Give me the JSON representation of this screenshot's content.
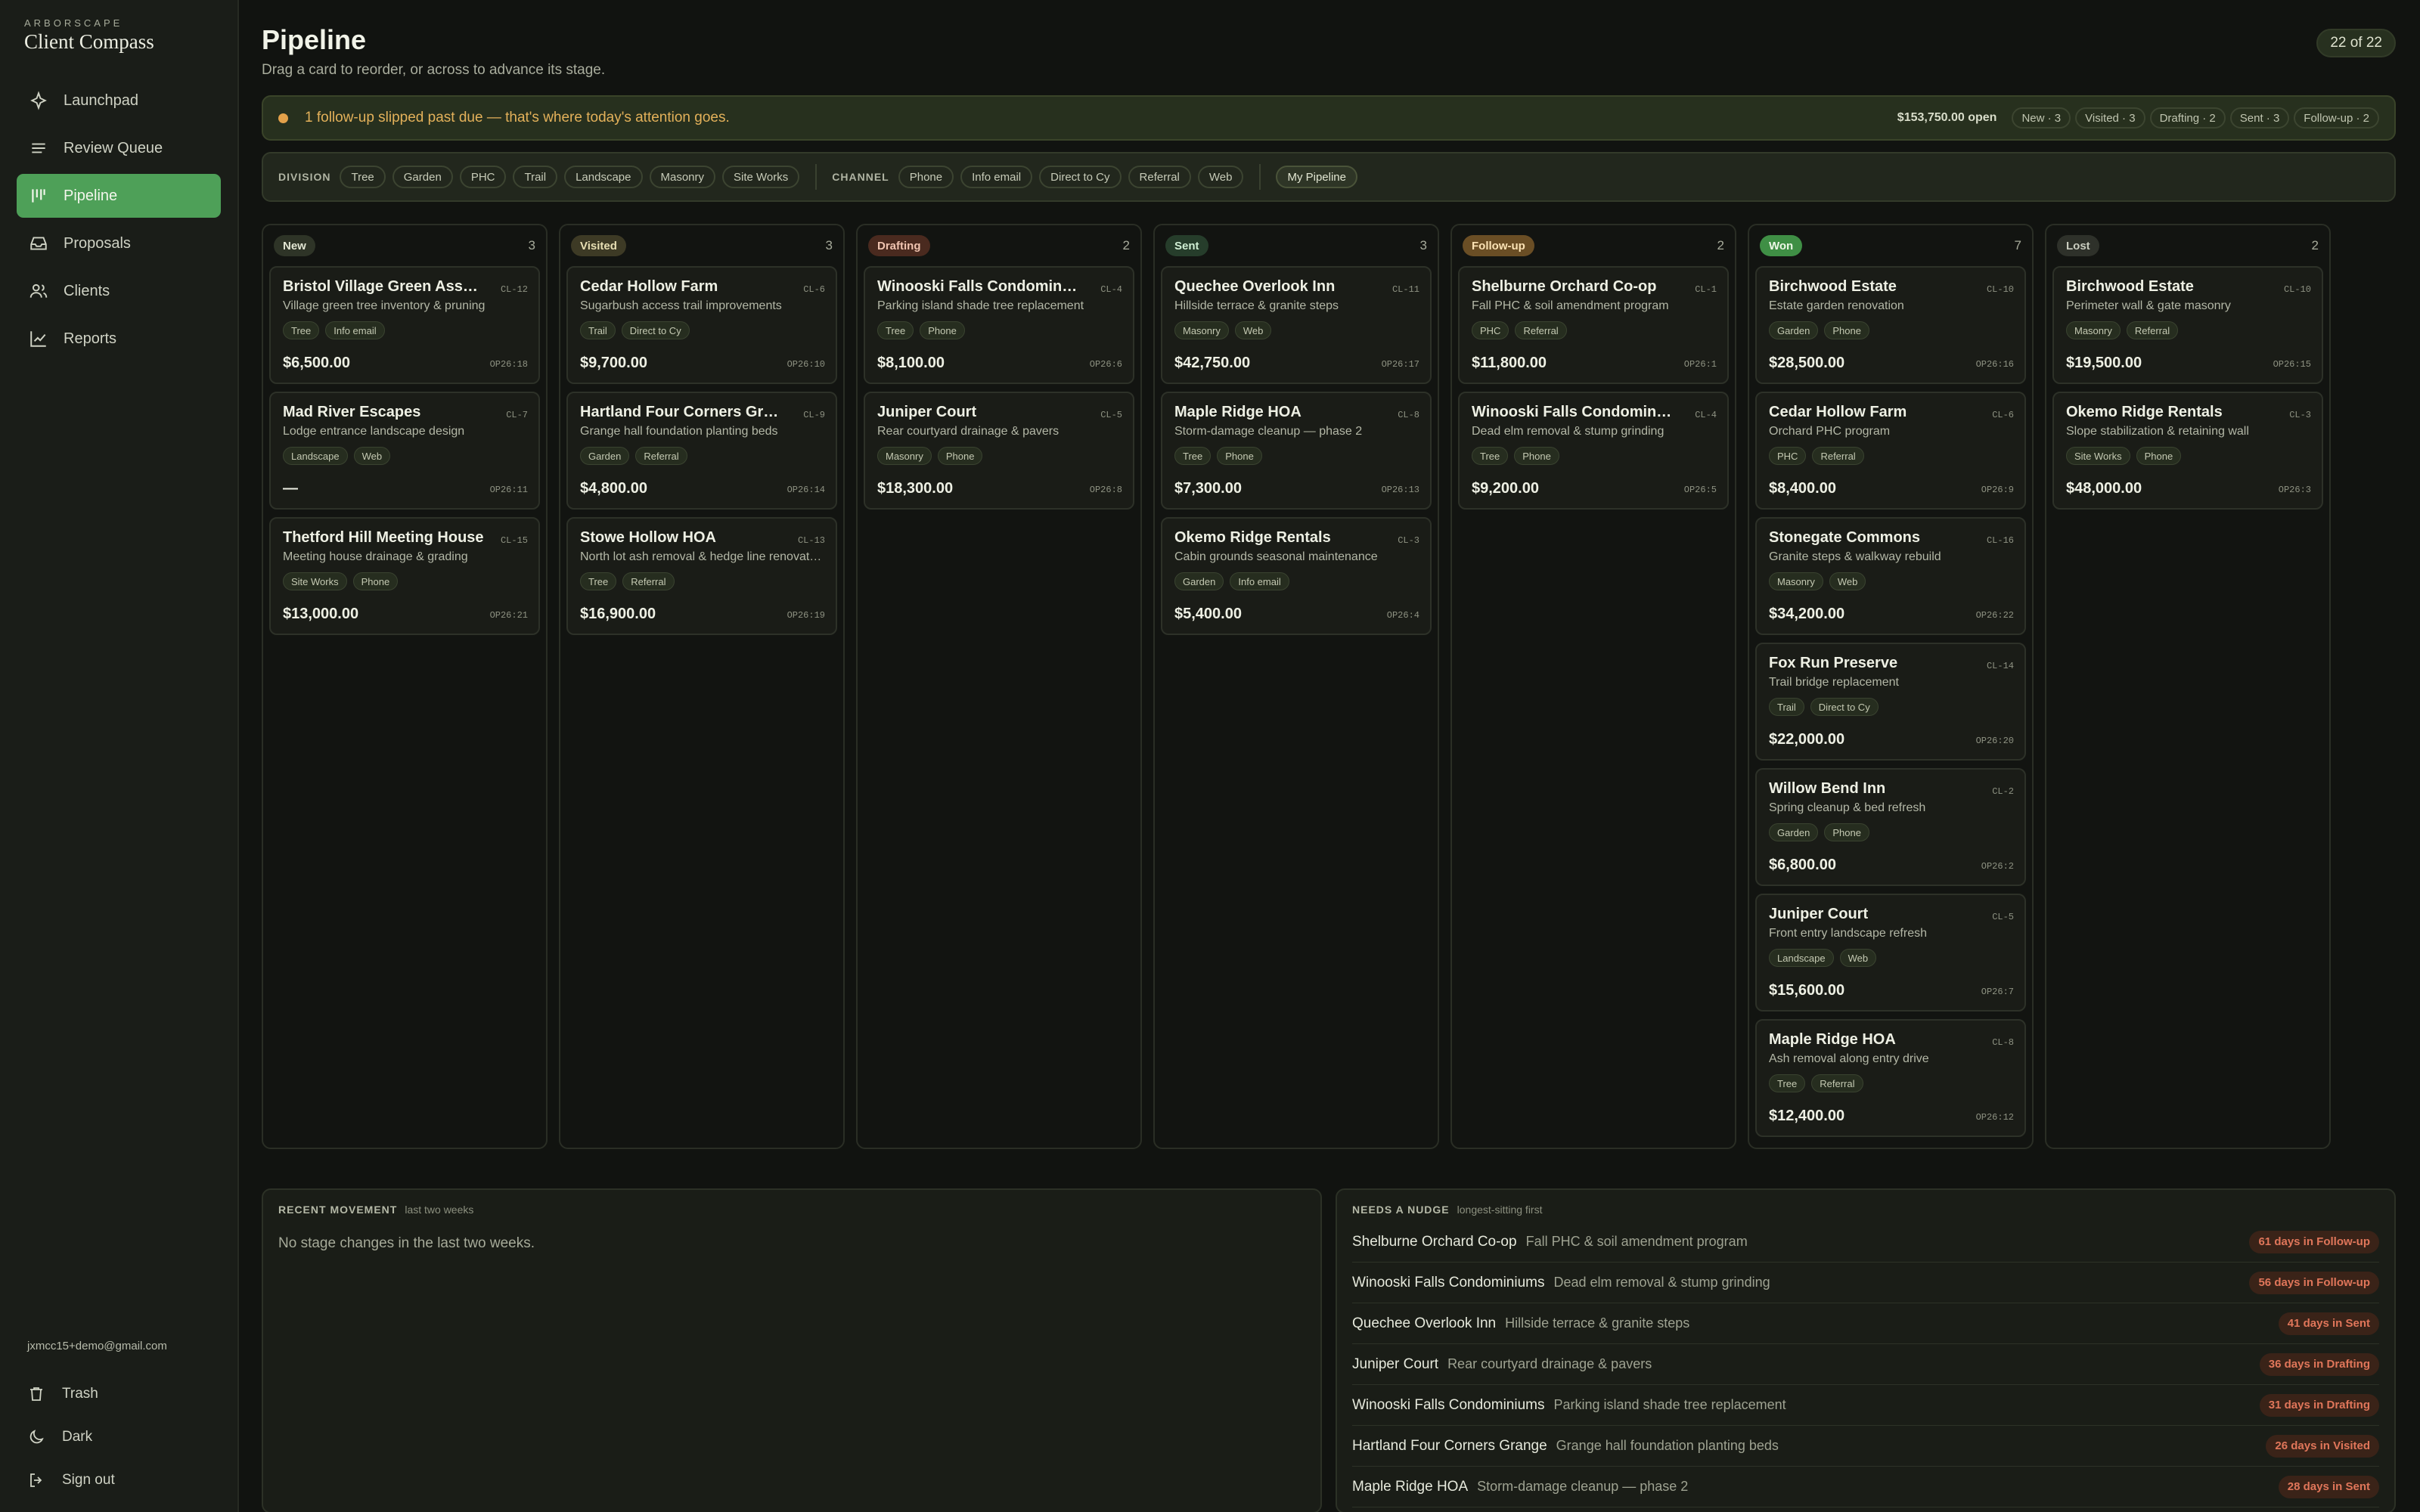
{
  "app": {
    "brand_small": "ARBORSCAPE",
    "brand_name": "Client Compass"
  },
  "nav": [
    {
      "label": "Launchpad",
      "icon": "sparkle-icon",
      "active": false
    },
    {
      "label": "Review Queue",
      "icon": "list-icon",
      "active": false
    },
    {
      "label": "Pipeline",
      "icon": "kanban-icon",
      "active": true
    },
    {
      "label": "Proposals",
      "icon": "inbox-icon",
      "active": false
    },
    {
      "label": "Clients",
      "icon": "users-icon",
      "active": false
    },
    {
      "label": "Reports",
      "icon": "chart-icon",
      "active": false
    }
  ],
  "footer": {
    "email": "jxmcc15+demo@gmail.com",
    "trash": "Trash",
    "theme": "Dark",
    "signout": "Sign out"
  },
  "header": {
    "title": "Pipeline",
    "subtitle": "Drag a card to reorder, or across to advance its stage.",
    "count": "22 of 22"
  },
  "alert": {
    "text": "1 follow-up slipped past due — that's where today's attention goes.",
    "open_total": "$153,750.00 open",
    "stages": [
      "New · 3",
      "Visited · 3",
      "Drafting · 2",
      "Sent · 3",
      "Follow-up · 2"
    ]
  },
  "filters": {
    "division_label": "DIVISION",
    "divisions": [
      "Tree",
      "Garden",
      "PHC",
      "Trail",
      "Landscape",
      "Masonry",
      "Site Works"
    ],
    "channel_label": "CHANNEL",
    "channels": [
      "Phone",
      "Info email",
      "Direct to Cy",
      "Referral",
      "Web"
    ],
    "mine": "My Pipeline"
  },
  "columns": [
    {
      "stage": "New",
      "count": "3",
      "badge_bg": "#2e3427",
      "badge_fg": "#e2e6d3",
      "cards": [
        {
          "name": "Bristol Village Green Association",
          "id": "CL-12",
          "desc": "Village green tree inventory & pruning",
          "tags": [
            "Tree",
            "Info email"
          ],
          "value": "$6,500.00",
          "op": "OP26:18"
        },
        {
          "name": "Mad River Escapes",
          "id": "CL-7",
          "desc": "Lodge entrance landscape design",
          "tags": [
            "Landscape",
            "Web"
          ],
          "value": "—",
          "op": "OP26:11"
        },
        {
          "name": "Thetford Hill Meeting House",
          "id": "CL-15",
          "desc": "Meeting house drainage & grading",
          "tags": [
            "Site Works",
            "Phone"
          ],
          "value": "$13,000.00",
          "op": "OP26:21"
        }
      ]
    },
    {
      "stage": "Visited",
      "count": "3",
      "badge_bg": "#3d3a25",
      "badge_fg": "#e7dfb3",
      "cards": [
        {
          "name": "Cedar Hollow Farm",
          "id": "CL-6",
          "desc": "Sugarbush access trail improvements",
          "tags": [
            "Trail",
            "Direct to Cy"
          ],
          "value": "$9,700.00",
          "op": "OP26:10"
        },
        {
          "name": "Hartland Four Corners Grange",
          "id": "CL-9",
          "desc": "Grange hall foundation planting beds",
          "tags": [
            "Garden",
            "Referral"
          ],
          "value": "$4,800.00",
          "op": "OP26:14"
        },
        {
          "name": "Stowe Hollow HOA",
          "id": "CL-13",
          "desc": "North lot ash removal & hedge line renovation",
          "tags": [
            "Tree",
            "Referral"
          ],
          "value": "$16,900.00",
          "op": "OP26:19"
        }
      ]
    },
    {
      "stage": "Drafting",
      "count": "2",
      "badge_bg": "#4a2a1f",
      "badge_fg": "#f0c4b0",
      "cards": [
        {
          "name": "Winooski Falls Condominiums",
          "id": "CL-4",
          "desc": "Parking island shade tree replacement",
          "tags": [
            "Tree",
            "Phone"
          ],
          "value": "$8,100.00",
          "op": "OP26:6"
        },
        {
          "name": "Juniper Court",
          "id": "CL-5",
          "desc": "Rear courtyard drainage & pavers",
          "tags": [
            "Masonry",
            "Phone"
          ],
          "value": "$18,300.00",
          "op": "OP26:8"
        }
      ]
    },
    {
      "stage": "Sent",
      "count": "3",
      "badge_bg": "#263d2b",
      "badge_fg": "#cfeed3",
      "cards": [
        {
          "name": "Quechee Overlook Inn",
          "id": "CL-11",
          "desc": "Hillside terrace & granite steps",
          "tags": [
            "Masonry",
            "Web"
          ],
          "value": "$42,750.00",
          "op": "OP26:17"
        },
        {
          "name": "Maple Ridge HOA",
          "id": "CL-8",
          "desc": "Storm-damage cleanup — phase 2",
          "tags": [
            "Tree",
            "Phone"
          ],
          "value": "$7,300.00",
          "op": "OP26:13"
        },
        {
          "name": "Okemo Ridge Rentals",
          "id": "CL-3",
          "desc": "Cabin grounds seasonal maintenance",
          "tags": [
            "Garden",
            "Info email"
          ],
          "value": "$5,400.00",
          "op": "OP26:4"
        }
      ]
    },
    {
      "stage": "Follow-up",
      "count": "2",
      "badge_bg": "#6a4e25",
      "badge_fg": "#fbe2b4",
      "cards": [
        {
          "name": "Shelburne Orchard Co-op",
          "id": "CL-1",
          "desc": "Fall PHC & soil amendment program",
          "tags": [
            "PHC",
            "Referral"
          ],
          "value": "$11,800.00",
          "op": "OP26:1"
        },
        {
          "name": "Winooski Falls Condominiums",
          "id": "CL-4",
          "desc": "Dead elm removal & stump grinding",
          "tags": [
            "Tree",
            "Phone"
          ],
          "value": "$9,200.00",
          "op": "OP26:5"
        }
      ]
    },
    {
      "stage": "Won",
      "count": "7",
      "badge_bg": "#3f8f45",
      "badge_fg": "#ecf7e6",
      "cards": [
        {
          "name": "Birchwood Estate",
          "id": "CL-10",
          "desc": "Estate garden renovation",
          "tags": [
            "Garden",
            "Phone"
          ],
          "value": "$28,500.00",
          "op": "OP26:16"
        },
        {
          "name": "Cedar Hollow Farm",
          "id": "CL-6",
          "desc": "Orchard PHC program",
          "tags": [
            "PHC",
            "Referral"
          ],
          "value": "$8,400.00",
          "op": "OP26:9"
        },
        {
          "name": "Stonegate Commons",
          "id": "CL-16",
          "desc": "Granite steps & walkway rebuild",
          "tags": [
            "Masonry",
            "Web"
          ],
          "value": "$34,200.00",
          "op": "OP26:22"
        },
        {
          "name": "Fox Run Preserve",
          "id": "CL-14",
          "desc": "Trail bridge replacement",
          "tags": [
            "Trail",
            "Direct to Cy"
          ],
          "value": "$22,000.00",
          "op": "OP26:20"
        },
        {
          "name": "Willow Bend Inn",
          "id": "CL-2",
          "desc": "Spring cleanup & bed refresh",
          "tags": [
            "Garden",
            "Phone"
          ],
          "value": "$6,800.00",
          "op": "OP26:2"
        },
        {
          "name": "Juniper Court",
          "id": "CL-5",
          "desc": "Front entry landscape refresh",
          "tags": [
            "Landscape",
            "Web"
          ],
          "value": "$15,600.00",
          "op": "OP26:7"
        },
        {
          "name": "Maple Ridge HOA",
          "id": "CL-8",
          "desc": "Ash removal along entry drive",
          "tags": [
            "Tree",
            "Referral"
          ],
          "value": "$12,400.00",
          "op": "OP26:12"
        }
      ]
    },
    {
      "stage": "Lost",
      "count": "2",
      "badge_bg": "#2e312a",
      "badge_fg": "#c9ccbf",
      "cards": [
        {
          "name": "Birchwood Estate",
          "id": "CL-10",
          "desc": "Perimeter wall & gate masonry",
          "tags": [
            "Masonry",
            "Referral"
          ],
          "value": "$19,500.00",
          "op": "OP26:15"
        },
        {
          "name": "Okemo Ridge Rentals",
          "id": "CL-3",
          "desc": "Slope stabilization & retaining wall",
          "tags": [
            "Site Works",
            "Phone"
          ],
          "value": "$48,000.00",
          "op": "OP26:3"
        }
      ]
    }
  ],
  "recent": {
    "title": "RECENT MOVEMENT",
    "sub": "last two weeks",
    "empty": "No stage changes in the last two weeks."
  },
  "nudges": {
    "title": "NEEDS A NUDGE",
    "sub": "longest-sitting first",
    "items": [
      {
        "name": "Shelburne Orchard Co-op",
        "desc": "Fall PHC & soil amendment program",
        "badge": "61 days in Follow-up"
      },
      {
        "name": "Winooski Falls Condominiums",
        "desc": "Dead elm removal & stump grinding",
        "badge": "56 days in Follow-up"
      },
      {
        "name": "Quechee Overlook Inn",
        "desc": "Hillside terrace & granite steps",
        "badge": "41 days in Sent"
      },
      {
        "name": "Juniper Court",
        "desc": "Rear courtyard drainage & pavers",
        "badge": "36 days in Drafting"
      },
      {
        "name": "Winooski Falls Condominiums",
        "desc": "Parking island shade tree replacement",
        "badge": "31 days in Drafting"
      },
      {
        "name": "Hartland Four Corners Grange",
        "desc": "Grange hall foundation planting beds",
        "badge": "26 days in Visited"
      },
      {
        "name": "Maple Ridge HOA",
        "desc": "Storm-damage cleanup — phase 2",
        "badge": "28 days in Sent"
      }
    ]
  }
}
